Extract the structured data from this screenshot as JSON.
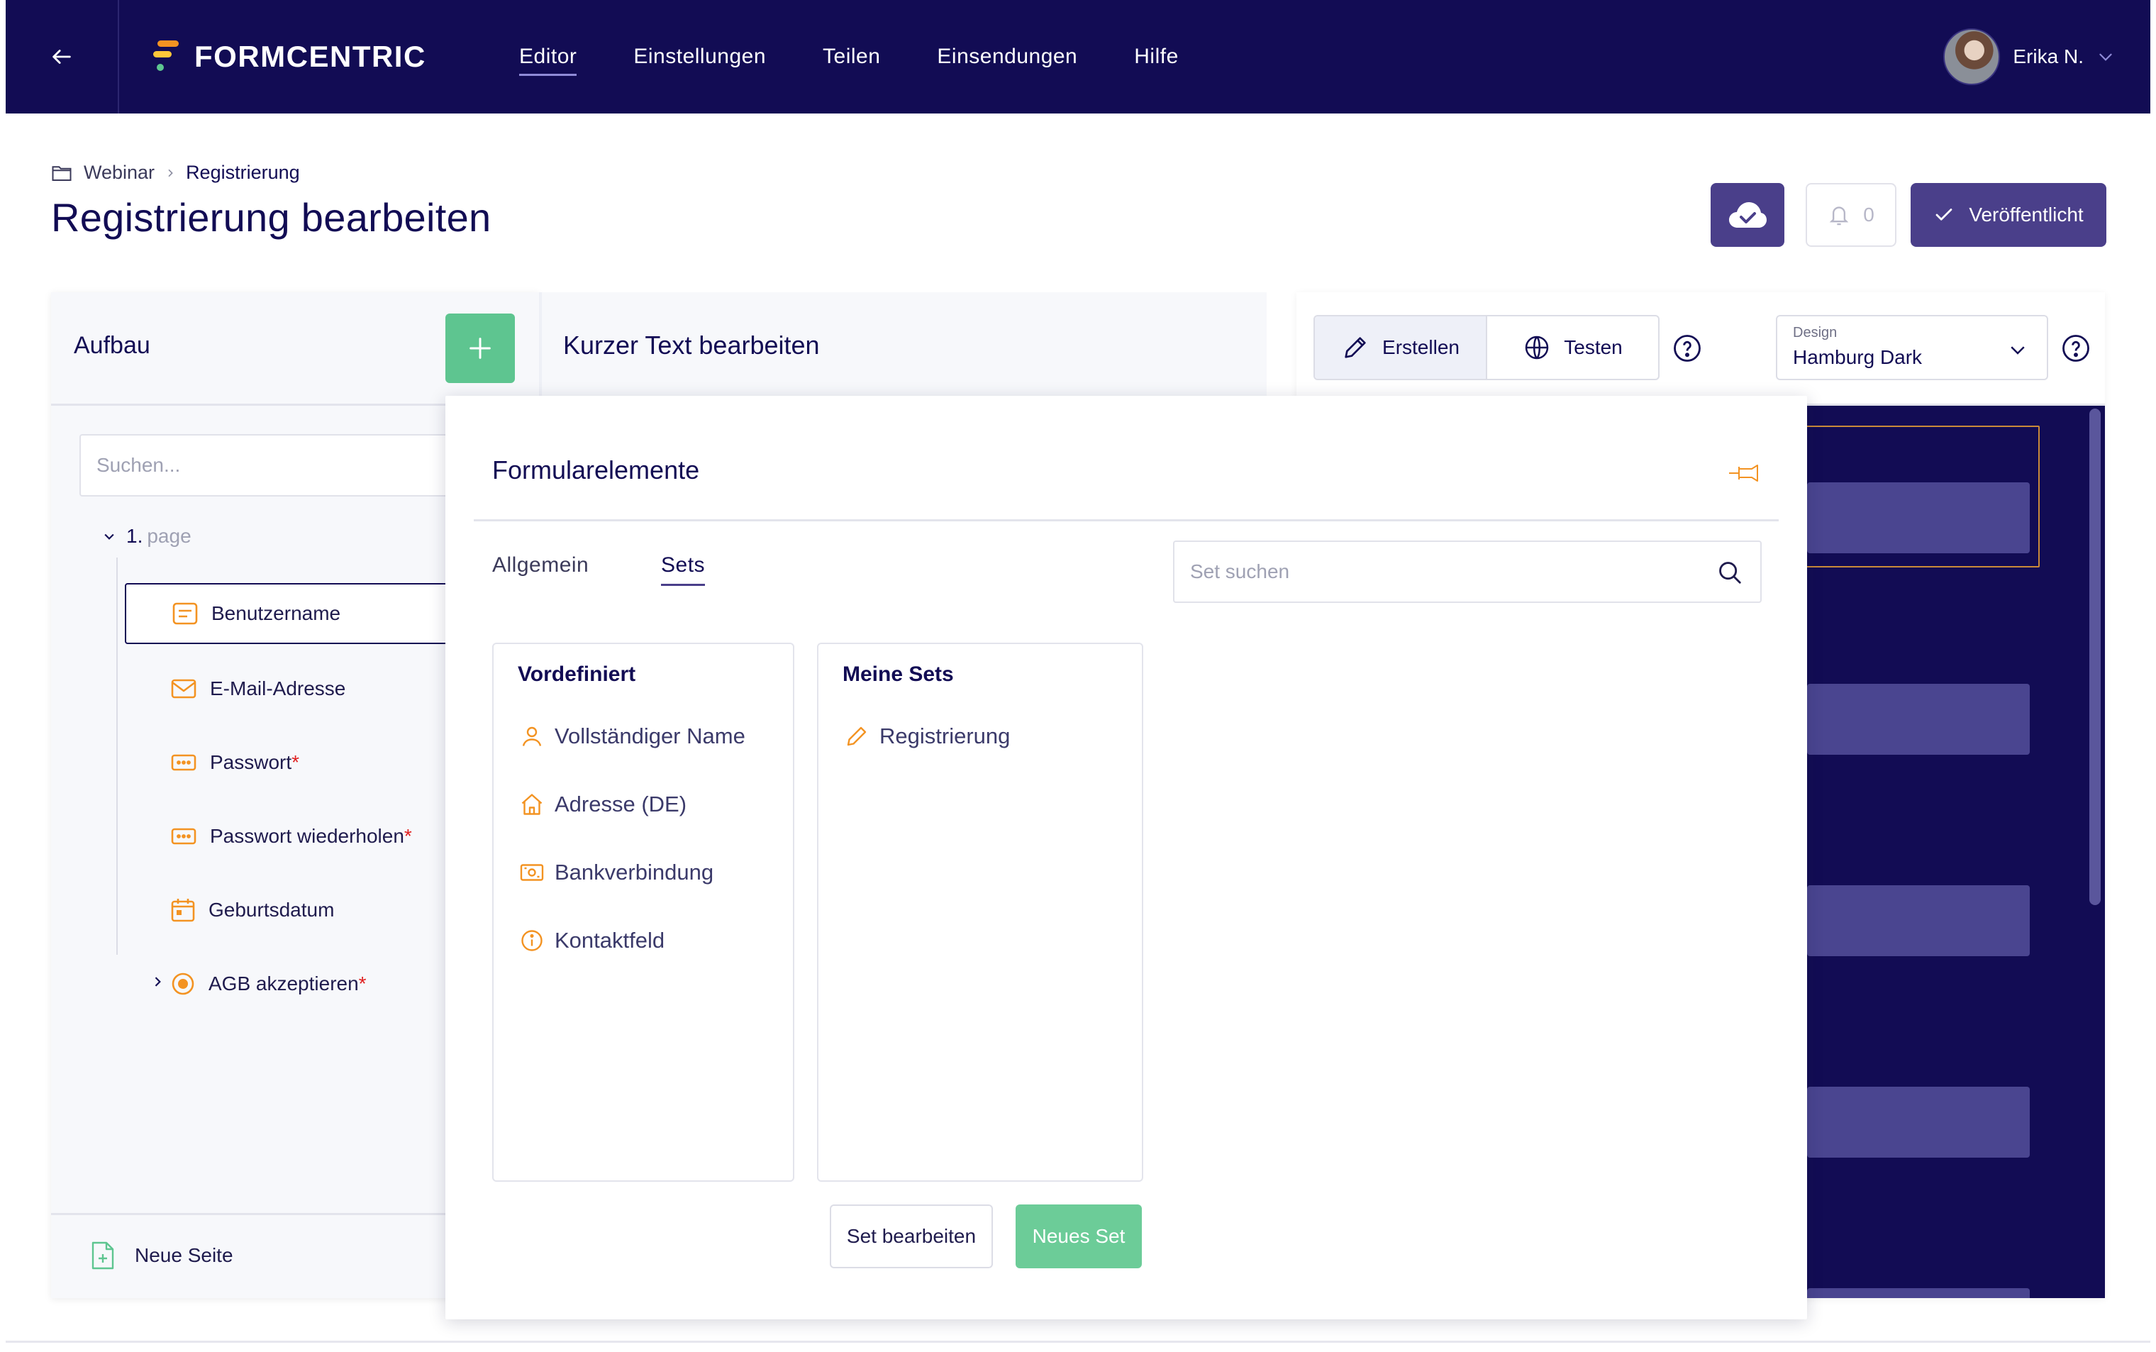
{
  "nav": {
    "brand": "FORMCENTRIC",
    "items": [
      {
        "label": "Editor",
        "active": true
      },
      {
        "label": "Einstellungen",
        "active": false
      },
      {
        "label": "Teilen",
        "active": false
      },
      {
        "label": "Einsendungen",
        "active": false
      },
      {
        "label": "Hilfe",
        "active": false
      }
    ],
    "user_name": "Erika N."
  },
  "breadcrumb": {
    "parent": "Webinar",
    "current": "Registrierung"
  },
  "page_title": "Registrierung bearbeiten",
  "actions": {
    "notification_count": "0",
    "publish_label": "Veröffentlicht"
  },
  "left_panel": {
    "title": "Aufbau",
    "search_placeholder": "Suchen...",
    "page_number": "1.",
    "page_label": "page",
    "items": [
      {
        "label": "Benutzername",
        "required": false,
        "icon": "text-field-icon"
      },
      {
        "label": "E-Mail-Adresse",
        "required": false,
        "icon": "mail-icon"
      },
      {
        "label": "Passwort",
        "required": true,
        "icon": "password-icon"
      },
      {
        "label": "Passwort wiederholen",
        "required": true,
        "icon": "password-icon"
      },
      {
        "label": "Geburtsdatum",
        "required": false,
        "icon": "calendar-icon"
      },
      {
        "label": "AGB akzeptieren",
        "required": true,
        "icon": "radio-icon"
      }
    ],
    "required_mark": "*",
    "new_page_label": "Neue Seite"
  },
  "middle_panel": {
    "title": "Kurzer Text bearbeiten"
  },
  "right_panel": {
    "mode_create": "Erstellen",
    "mode_test": "Testen",
    "design_label": "Design",
    "design_value": "Hamburg Dark"
  },
  "overlay": {
    "title": "Formularelemente",
    "tabs": [
      {
        "label": "Allgemein",
        "active": false
      },
      {
        "label": "Sets",
        "active": true
      }
    ],
    "set_search_placeholder": "Set suchen",
    "predefined": {
      "title": "Vordefiniert",
      "items": [
        {
          "label": "Vollständiger Name",
          "icon": "user-icon"
        },
        {
          "label": "Adresse (DE)",
          "icon": "home-icon"
        },
        {
          "label": "Bankverbindung",
          "icon": "banknote-icon"
        },
        {
          "label": "Kontaktfeld",
          "icon": "info-icon"
        }
      ]
    },
    "my_sets": {
      "title": "Meine Sets",
      "items": [
        {
          "label": "Registrierung",
          "icon": "pencil-icon"
        }
      ]
    },
    "edit_set_label": "Set bearbeiten",
    "new_set_label": "Neues Set"
  },
  "colors": {
    "nav_bg": "#120c54",
    "primary": "#4a3f8a",
    "accent_orange": "#f39322",
    "success_green": "#5ec590",
    "preview_bg": "#120c54"
  }
}
